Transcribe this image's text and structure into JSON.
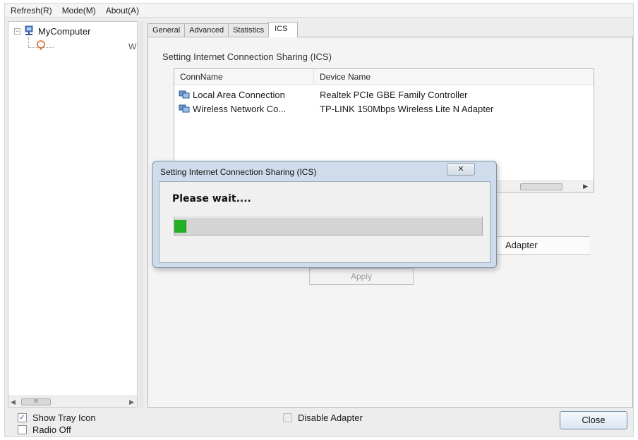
{
  "menu": [
    "Refresh(R)",
    "Mode(M)",
    "About(A)"
  ],
  "tree": {
    "root_label": "MyComputer",
    "cut_text": "W"
  },
  "tree_scroll_thumb": "III",
  "tabs": [
    {
      "label": "General",
      "active": false
    },
    {
      "label": "Advanced",
      "active": false
    },
    {
      "label": "Statistics",
      "active": false
    },
    {
      "label": "ICS",
      "active": true
    }
  ],
  "ics": {
    "section_title": "Setting Internet Connection Sharing (ICS)",
    "columns": [
      "ConnName",
      "Device Name"
    ],
    "rows": [
      {
        "name": "Local Area Connection",
        "device": "Realtek PCIe GBE Family Controller"
      },
      {
        "name": "Wireless Network Co...",
        "device": "TP-LINK 150Mbps Wireless Lite N Adapter"
      }
    ],
    "behind_text": "Adapter",
    "apply_label": "Apply"
  },
  "bottom": {
    "show_tray_icon": {
      "label": "Show Tray Icon",
      "checked": true
    },
    "radio_off": {
      "label": "Radio Off",
      "checked": false
    },
    "disable_adapter": {
      "label": "Disable Adapter",
      "checked": false
    },
    "close_label": "Close",
    "check_glyph": "✓"
  },
  "dialog": {
    "title": "Setting Internet Connection Sharing (ICS)",
    "close_glyph": "✕",
    "message": "Please wait....",
    "progress_fraction": 0.04
  },
  "colors": {
    "progress_fill": "#23b024",
    "accent_border": "#6e8fb5"
  }
}
